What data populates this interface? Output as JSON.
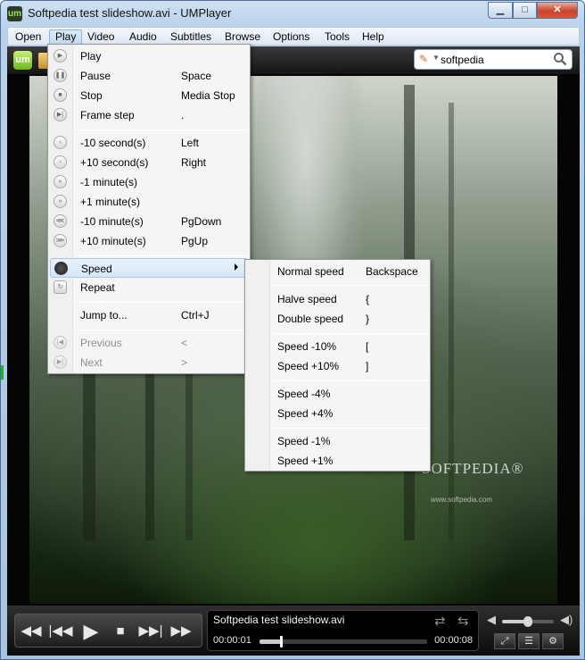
{
  "window": {
    "title": "Softpedia test slideshow.avi - UMPlayer",
    "app_icon_text": "um",
    "minimize": "▁",
    "maximize": "□",
    "close": "✕"
  },
  "menubar": [
    "Open",
    "Play",
    "Video",
    "Audio",
    "Subtitles",
    "Browse",
    "Options",
    "Tools",
    "Help"
  ],
  "toolbar": {
    "logo": "um",
    "search_value": "softpedia",
    "search_placeholder": "Search"
  },
  "play_menu": {
    "items": [
      {
        "label": "Play",
        "shortcut": "",
        "icon": "play-icon"
      },
      {
        "label": "Pause",
        "shortcut": "Space",
        "icon": "pause-icon"
      },
      {
        "label": "Stop",
        "shortcut": "Media Stop",
        "icon": "stop-icon"
      },
      {
        "label": "Frame step",
        "shortcut": ".",
        "icon": "frame-step-icon"
      },
      {
        "label": "-10 second(s)",
        "shortcut": "Left",
        "icon": "rewind-small-icon"
      },
      {
        "label": "+10 second(s)",
        "shortcut": "Right",
        "icon": "forward-small-icon"
      },
      {
        "label": "-1 minute(s)",
        "shortcut": "",
        "icon": "rewind-icon"
      },
      {
        "label": "+1 minute(s)",
        "shortcut": "",
        "icon": "forward-icon"
      },
      {
        "label": "-10 minute(s)",
        "shortcut": "PgDown",
        "icon": "rewind-large-icon"
      },
      {
        "label": "+10 minute(s)",
        "shortcut": "PgUp",
        "icon": "forward-large-icon"
      },
      {
        "label": "Speed",
        "shortcut": "",
        "icon": "speed-icon"
      },
      {
        "label": "Repeat",
        "shortcut": "",
        "icon": "repeat-icon"
      },
      {
        "label": "Jump to...",
        "shortcut": "Ctrl+J",
        "icon": ""
      },
      {
        "label": "Previous",
        "shortcut": "<",
        "icon": "previous-icon"
      },
      {
        "label": "Next",
        "shortcut": ">",
        "icon": "next-icon"
      }
    ]
  },
  "speed_menu": {
    "items": [
      {
        "label": "Normal speed",
        "shortcut": "Backspace"
      },
      {
        "label": "Halve speed",
        "shortcut": "{"
      },
      {
        "label": "Double speed",
        "shortcut": "}"
      },
      {
        "label": "Speed -10%",
        "shortcut": "["
      },
      {
        "label": "Speed +10%",
        "shortcut": "]"
      },
      {
        "label": "Speed -4%",
        "shortcut": ""
      },
      {
        "label": "Speed +4%",
        "shortcut": ""
      },
      {
        "label": "Speed -1%",
        "shortcut": ""
      },
      {
        "label": "Speed +1%",
        "shortcut": ""
      }
    ]
  },
  "video": {
    "watermark": "SOFTPEDIA®",
    "watermark_url": "www.softpedia.com"
  },
  "playback": {
    "file_name": "Softpedia test slideshow.avi",
    "current_time": "00:00:01",
    "total_time": "00:00:08",
    "progress": 0.125,
    "volume": 0.5
  },
  "colors": {
    "accent": "#9ee34a",
    "highlight": "#d6e6f7"
  }
}
